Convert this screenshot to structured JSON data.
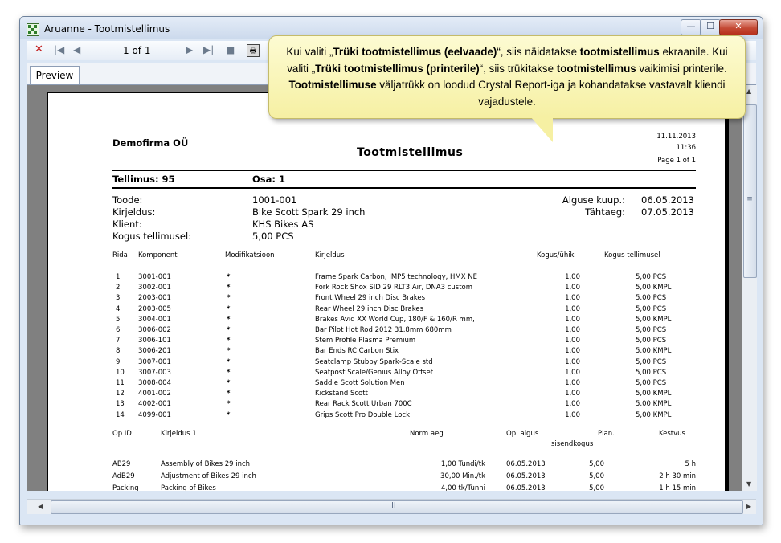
{
  "window": {
    "title": "Aruanne - Tootmistellimus",
    "minimize": "—",
    "maximize": "☐",
    "close": "✕"
  },
  "toolbar": {
    "stop": "✕",
    "first": "|◀",
    "prev": "◀",
    "page": "1 of 1",
    "next": "▶",
    "last": "▶|",
    "stopbtn": "■",
    "print": "🖶"
  },
  "tab": {
    "label": "Preview"
  },
  "callout": {
    "parts": [
      {
        "t": "Kui valiti „",
        "b": false
      },
      {
        "t": "Trüki tootmistellimus (eelvaade)",
        "b": true
      },
      {
        "t": "“, siis näidatakse ",
        "b": false
      },
      {
        "t": "tootmistellimus",
        "b": true
      },
      {
        "t": " ekraanile. Kui valiti „",
        "b": false
      },
      {
        "t": "Trüki tootmistellimus (printerile)",
        "b": true
      },
      {
        "t": "“, siis trükitakse ",
        "b": false
      },
      {
        "t": "tootmistellimus",
        "b": true
      },
      {
        "t": " vaikimisi printerile. ",
        "b": false
      },
      {
        "t": "Tootmistellimuse",
        "b": true
      },
      {
        "t": " väljatrükk on loodud Crystal Report-iga ja kohandatakse vastavalt kliendi vajadustele.",
        "b": false
      }
    ]
  },
  "report": {
    "company": "Demofirma OÜ",
    "title": "Tootmistellimus",
    "date": "11.11.2013",
    "time": "11:36",
    "page": "Page 1 of 1",
    "order_label": "Tellimus: 95",
    "part_label": "Osa: 1",
    "product_label": "Toode:",
    "product_value": "1001-001",
    "desc_label": "Kirjeldus:",
    "desc_value": "Bike Scott Spark 29 inch",
    "client_label": "Klient:",
    "client_value": "KHS Bikes AS",
    "qty_label": "Kogus tellimusel:",
    "qty_value": "5,00  PCS",
    "start_label": "Alguse kuup.:",
    "start_value": "06.05.2013",
    "due_label": "Tähtaeg:",
    "due_value": "07.05.2013",
    "comp_headers": [
      "Rida",
      "Komponent",
      "Modifikatsioon",
      "Kirjeldus",
      "Kogus/ühik",
      "Kogus tellimusel"
    ],
    "components": [
      [
        "1",
        "3001-001",
        "*",
        "Frame Spark Carbon, IMP5 technology, HMX NE",
        "1,00",
        "5,00 PCS"
      ],
      [
        "2",
        "3002-001",
        "*",
        "Fork Rock Shox SID 29 RLT3 Air, DNA3 custom",
        "1,00",
        "5,00 KMPL"
      ],
      [
        "3",
        "2003-001",
        "*",
        "Front Wheel 29 inch Disc Brakes",
        "1,00",
        "5,00 PCS"
      ],
      [
        "4",
        "2003-005",
        "*",
        "Rear Wheel 29 inch Disc Brakes",
        "1,00",
        "5,00 PCS"
      ],
      [
        "5",
        "3004-001",
        "*",
        "Brakes Avid XX World Cup, 180/F & 160/R mm,",
        "1,00",
        "5,00 KMPL"
      ],
      [
        "6",
        "3006-002",
        "*",
        "Bar Pilot Hot Rod 2012 31.8mm 680mm",
        "1,00",
        "5,00 PCS"
      ],
      [
        "7",
        "3006-101",
        "*",
        "Stem Profile Plasma Premium",
        "1,00",
        "5,00 PCS"
      ],
      [
        "8",
        "3006-201",
        "*",
        "Bar Ends RC Carbon Stix",
        "1,00",
        "5,00 KMPL"
      ],
      [
        "9",
        "3007-001",
        "*",
        "Seatclamp Stubby Spark-Scale std",
        "1,00",
        "5,00 PCS"
      ],
      [
        "10",
        "3007-003",
        "*",
        "Seatpost Scale/Genius Alloy Offset",
        "1,00",
        "5,00 PCS"
      ],
      [
        "11",
        "3008-004",
        "*",
        "Saddle Scott Solution Men",
        "1,00",
        "5,00 PCS"
      ],
      [
        "12",
        "4001-002",
        "*",
        "Kickstand Scott",
        "1,00",
        "5,00 KMPL"
      ],
      [
        "13",
        "4002-001",
        "*",
        "Rear Rack Scott Urban 700C",
        "1,00",
        "5,00 KMPL"
      ],
      [
        "14",
        "4099-001",
        "*",
        "Grips Scott Pro Double Lock",
        "1,00",
        "5,00 KMPL"
      ]
    ],
    "op_headers": [
      "Op ID",
      "Kirjeldus 1",
      "Norm aeg",
      "Op. algus",
      "Plan.",
      "sisendkogus",
      "Kestvus"
    ],
    "operations": [
      [
        "AB29",
        "Assembly of Bikes 29 inch",
        "1,00 Tundi/tk",
        "06.05.2013",
        "5,00",
        "5 h"
      ],
      [
        "AdB29",
        "Adjustment of Bikes 29 inch",
        "30,00 Min./tk",
        "06.05.2013",
        "5,00",
        "2 h  30 min"
      ],
      [
        "Packing",
        "Packing of Bikes",
        "4,00 tk/Tunni",
        "06.05.2013",
        "5,00",
        "1 h  15 min"
      ]
    ]
  },
  "scroll": {
    "vgrip": "≡",
    "hgrip": "III",
    "up": "▲",
    "down": "▼",
    "left": "◀",
    "right": "▶"
  }
}
